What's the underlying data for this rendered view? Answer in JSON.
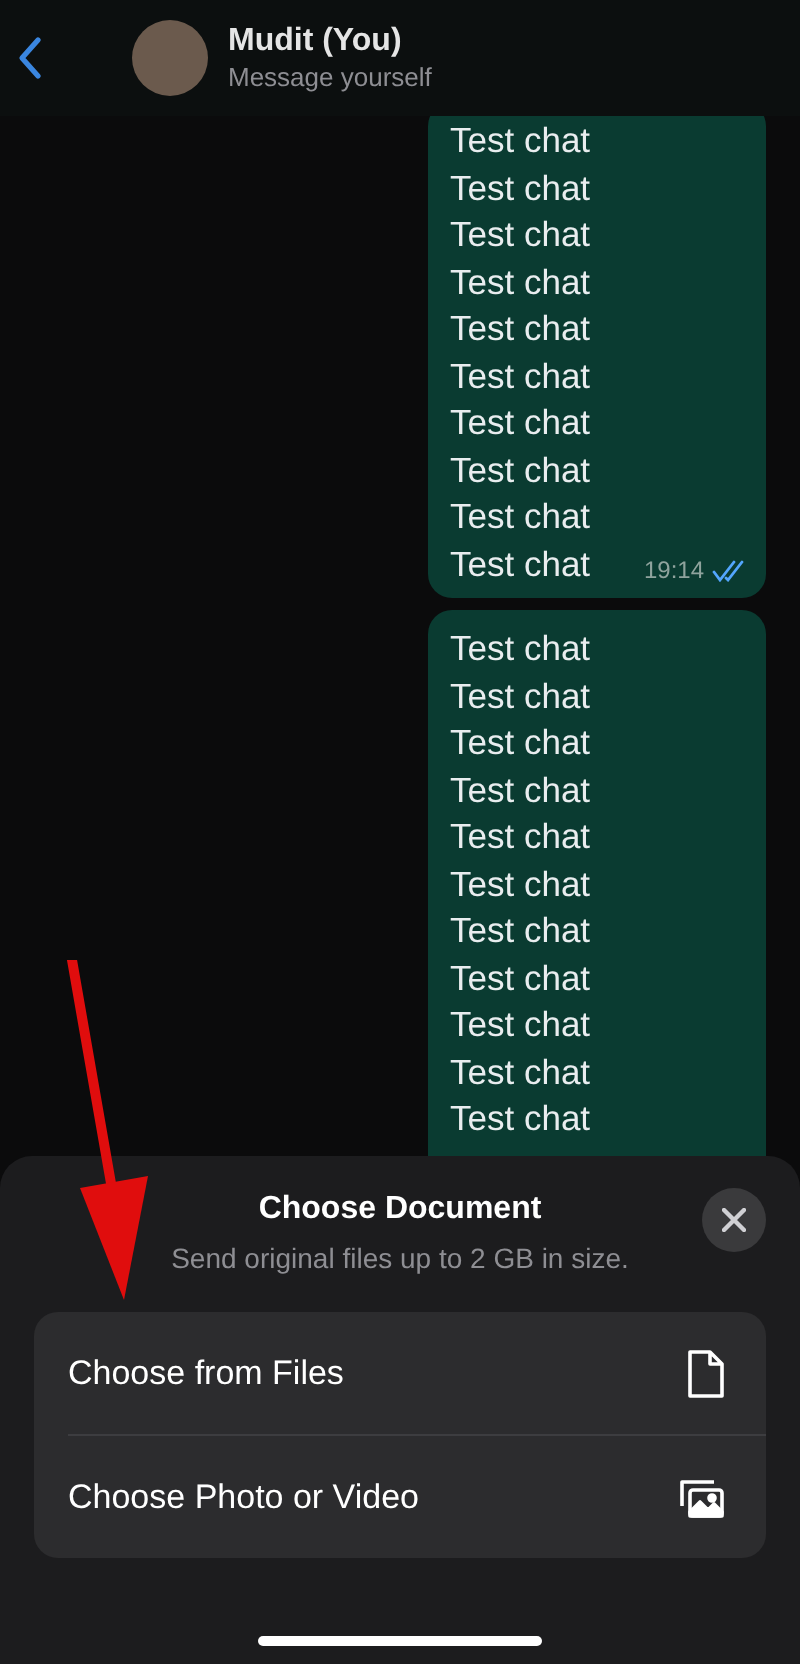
{
  "header": {
    "name": "Mudit (You)",
    "status": "Message yourself"
  },
  "messages": [
    {
      "lines": [
        "Test chat",
        "Test chat",
        "Test chat",
        "Test chat",
        "Test chat",
        "Test chat",
        "Test chat",
        "Test chat",
        "Test chat",
        "Test chat"
      ],
      "time": "19:14",
      "read": true
    },
    {
      "lines": [
        "Test chat",
        "Test chat",
        "Test chat",
        "Test chat",
        "Test chat",
        "Test chat",
        "Test chat",
        "Test chat",
        "Test chat",
        "Test chat",
        "Test chat"
      ]
    }
  ],
  "sheet": {
    "title": "Choose Document",
    "subtitle": "Send original files up to 2 GB in size.",
    "options": [
      {
        "label": "Choose from Files",
        "kind": "file"
      },
      {
        "label": "Choose Photo or Video",
        "kind": "photos"
      }
    ]
  }
}
